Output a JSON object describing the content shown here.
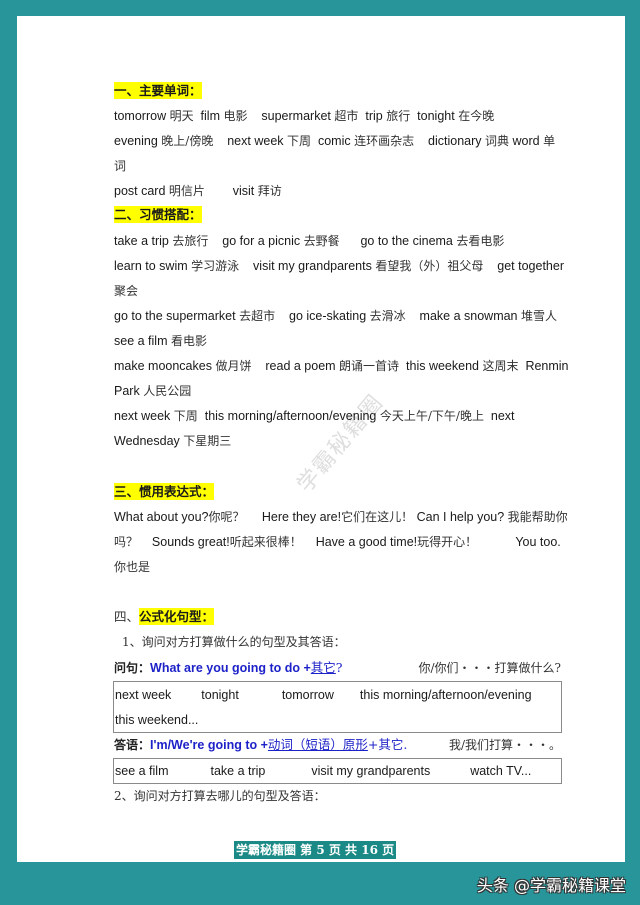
{
  "frame": {
    "border_color": "#27959a",
    "highlight_color": "#ffff00",
    "accent_blue": "#1d22c8"
  },
  "watermark": "学霸秘籍圈",
  "section1": {
    "heading": "一、主要单词：",
    "lines": [
      [
        "tomorrow",
        "明天",
        "film",
        "电影",
        "supermarket",
        "超市",
        "trip",
        "旅行",
        "tonight",
        "在今晚"
      ],
      [
        "evening",
        "晚上/傍晚",
        "next week",
        "下周",
        "comic",
        "连环画杂志",
        "dictionary",
        "词典",
        "word",
        "单"
      ],
      [
        "词"
      ],
      [
        "post card",
        "明信片",
        "visit",
        "拜访"
      ]
    ]
  },
  "section2": {
    "heading": "二、习惯搭配：",
    "lines": [
      [
        "take a trip",
        "去旅行",
        "go for a picnic",
        "去野餐",
        "go to the cinema",
        "去看电影"
      ],
      [
        "learn to swim",
        "学习游泳",
        "visit my grandparents",
        "看望我（外）祖父母",
        "get together"
      ],
      [
        "聚会"
      ],
      [
        "go to the supermarket",
        "去超市",
        "go ice-skating",
        "去滑冰",
        "make a snowman",
        "堆雪人"
      ],
      [
        "see a film",
        "看电影"
      ],
      [
        "make mooncakes",
        "做月饼",
        "read a poem",
        "朗诵一首诗",
        "this weekend",
        "这周末",
        "Renmin"
      ],
      [
        "Park",
        "人民公园"
      ],
      [
        "next week",
        "下周",
        "this morning/afternoon/evening",
        "今天上午/下午/晚上",
        "next"
      ],
      [
        "Wednesday",
        "下星期三"
      ]
    ]
  },
  "section3": {
    "heading": "三、惯用表达式：",
    "lines": [
      [
        "What about you?",
        "你呢？",
        "Here they are!",
        "它们在这儿！",
        "Can I help you?",
        "我能帮助你"
      ],
      [
        "吗？",
        "Sounds great!",
        "听起来很棒！",
        "Have a good time!",
        "玩得开心！",
        "You too."
      ],
      [
        "你也是"
      ]
    ]
  },
  "section4": {
    "heading_prefix": "四、",
    "heading": "公式化句型：",
    "sub1": "1、询问对方打算做什么的句型及其答语：",
    "question": {
      "label": "问句：",
      "en": "What are you going to do +",
      "cn_underlined": "其它",
      "end": "?",
      "translation": "你/你们・・・打算做什么?"
    },
    "box1": {
      "row1": [
        "next week",
        "tonight",
        "tomorrow",
        "this morning/afternoon/evening"
      ],
      "row2": [
        "this weekend..."
      ]
    },
    "answer": {
      "label": "答语：",
      "en": "I'm/We're going to +",
      "cn_underlined": "动词（短语）原形",
      "plus": "+其它.",
      "translation": "我/我们打算・・・。"
    },
    "box2": {
      "row1": [
        "see a film",
        "take a trip",
        "visit my grandparents",
        "watch TV..."
      ]
    },
    "sub2": "2、询问对方打算去哪儿的句型及答语："
  },
  "footer": {
    "text": "学霸秘籍圈 第 5 页 共 16 页"
  },
  "source_watermark": "头条 @学霸秘籍课堂"
}
